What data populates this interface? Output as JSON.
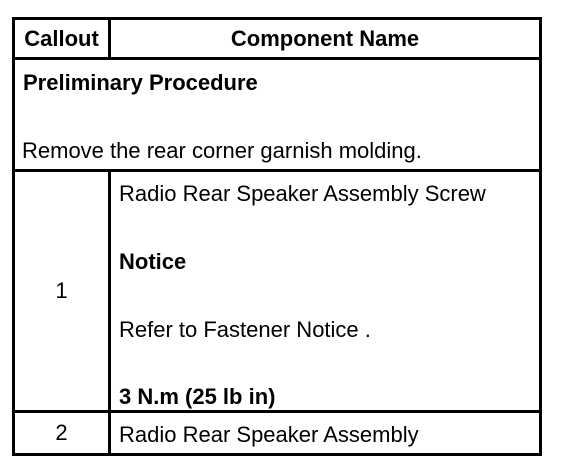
{
  "table": {
    "headers": {
      "callout": "Callout",
      "component_name": "Component Name"
    },
    "preliminary": {
      "title": "Preliminary Procedure",
      "text": "Remove the rear corner garnish molding."
    },
    "rows": [
      {
        "callout": "1",
        "component": "Radio Rear Speaker Assembly Screw",
        "notice_label": "Notice",
        "notice_text": "Refer to Fastener Notice .",
        "torque": "3 N.m (25 lb in)"
      },
      {
        "callout": "2",
        "component": "Radio Rear Speaker Assembly"
      }
    ]
  }
}
